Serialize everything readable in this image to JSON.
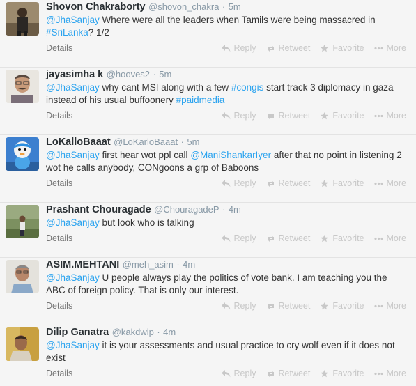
{
  "tweets": [
    {
      "name": "Shovon Chakraborty",
      "handle": "@shovon_chakra",
      "sep": "·",
      "time": "5m",
      "segments": [
        {
          "t": "@JhaSanjay",
          "link": true
        },
        {
          "t": " Where were all the leaders when Tamils were being massacred in ",
          "link": false
        },
        {
          "t": "#SriLanka",
          "link": true
        },
        {
          "t": "? 1/2",
          "link": false
        }
      ]
    },
    {
      "name": "jayasimha k",
      "handle": "@hooves2",
      "sep": "·",
      "time": "5m",
      "segments": [
        {
          "t": "@JhaSanjay",
          "link": true
        },
        {
          "t": " why cant MSI along with a few ",
          "link": false
        },
        {
          "t": "#congis",
          "link": true
        },
        {
          "t": " start track 3 diplomacy in gaza instead of his usual buffoonery ",
          "link": false
        },
        {
          "t": "#paidmedia",
          "link": true
        }
      ]
    },
    {
      "name": "LoKalloBaaat",
      "handle": "@LoKarloBaaat",
      "sep": "·",
      "time": "5m",
      "segments": [
        {
          "t": "@JhaSanjay",
          "link": true
        },
        {
          "t": " first hear wot ppl call ",
          "link": false
        },
        {
          "t": "@ManiShankarIyer",
          "link": true
        },
        {
          "t": " after that no point in listening 2 wot he calls anybody, CONgoons a grp of Baboons",
          "link": false
        }
      ]
    },
    {
      "name": "Prashant Chouragade",
      "handle": "@ChouragadeP",
      "sep": "·",
      "time": "4m",
      "segments": [
        {
          "t": "@JhaSanjay",
          "link": true
        },
        {
          "t": " but look who is talking",
          "link": false
        }
      ]
    },
    {
      "name": "ASIM.MEHTANI",
      "handle": "@meh_asim",
      "sep": "·",
      "time": "4m",
      "segments": [
        {
          "t": "@JhaSanjay",
          "link": true
        },
        {
          "t": " U people always play the politics of vote bank. I am teaching you the ABC of foreign policy. That is only our interest.",
          "link": false
        }
      ]
    },
    {
      "name": "Dilip Ganatra",
      "handle": "@kakdwip",
      "sep": "·",
      "time": "4m",
      "segments": [
        {
          "t": "@JhaSanjay",
          "link": true
        },
        {
          "t": " it is your assessments and usual practice to cry wolf even if it does not exist",
          "link": false
        }
      ]
    }
  ],
  "actions": {
    "details": "Details",
    "reply": "Reply",
    "retweet": "Retweet",
    "favorite": "Favorite",
    "more": "More"
  },
  "icons": [
    "reply-icon",
    "retweet-icon",
    "favorite-icon",
    "more-icon"
  ],
  "colors": {
    "link": "#2aa3ef",
    "name": "#292f33",
    "muted": "#8899a6",
    "action": "#c8c8c8",
    "background": "#f5f5f5",
    "divider": "#e3e3e3"
  }
}
